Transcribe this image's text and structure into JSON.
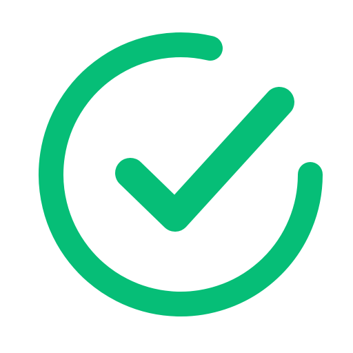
{
  "icon": {
    "name": "check-circle-icon",
    "color": "#06BE77",
    "background": "#FFFFFF"
  }
}
